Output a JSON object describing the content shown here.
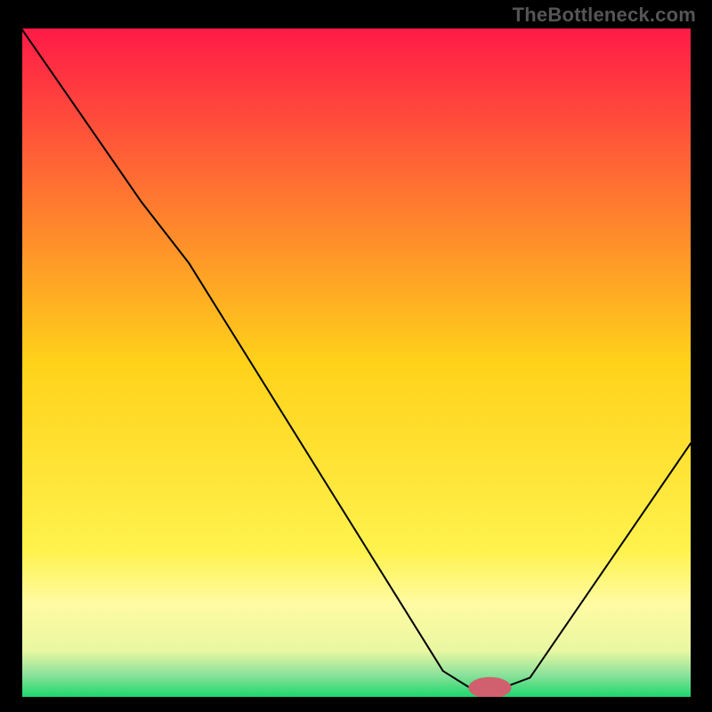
{
  "watermark": "TheBottleneck.com",
  "chart_data": {
    "type": "line",
    "title": "",
    "xlabel": "",
    "ylabel": "",
    "xlim": [
      0,
      100
    ],
    "ylim": [
      0,
      100
    ],
    "grid": false,
    "background_gradient": {
      "stops": [
        {
          "offset": 0.0,
          "color": "#ff1a47"
        },
        {
          "offset": 0.5,
          "color": "#ffd21a"
        },
        {
          "offset": 0.78,
          "color": "#fff24d"
        },
        {
          "offset": 0.86,
          "color": "#fffba3"
        },
        {
          "offset": 0.93,
          "color": "#e9f7a1"
        },
        {
          "offset": 0.965,
          "color": "#8de29b"
        },
        {
          "offset": 1.0,
          "color": "#1ad66a"
        }
      ]
    },
    "curve": {
      "stroke": "#000000",
      "stroke_width": 2,
      "points": [
        {
          "x": 0,
          "y": 100
        },
        {
          "x": 18,
          "y": 74
        },
        {
          "x": 25,
          "y": 65
        },
        {
          "x": 63,
          "y": 4
        },
        {
          "x": 67,
          "y": 1.5
        },
        {
          "x": 72,
          "y": 1.5
        },
        {
          "x": 76,
          "y": 3
        },
        {
          "x": 100,
          "y": 38
        }
      ]
    },
    "marker": {
      "cx": 70,
      "cy": 1.5,
      "rx": 3.2,
      "ry": 1.6,
      "fill": "#d1606e"
    },
    "axes": {
      "color": "#000000",
      "width": 2
    }
  }
}
